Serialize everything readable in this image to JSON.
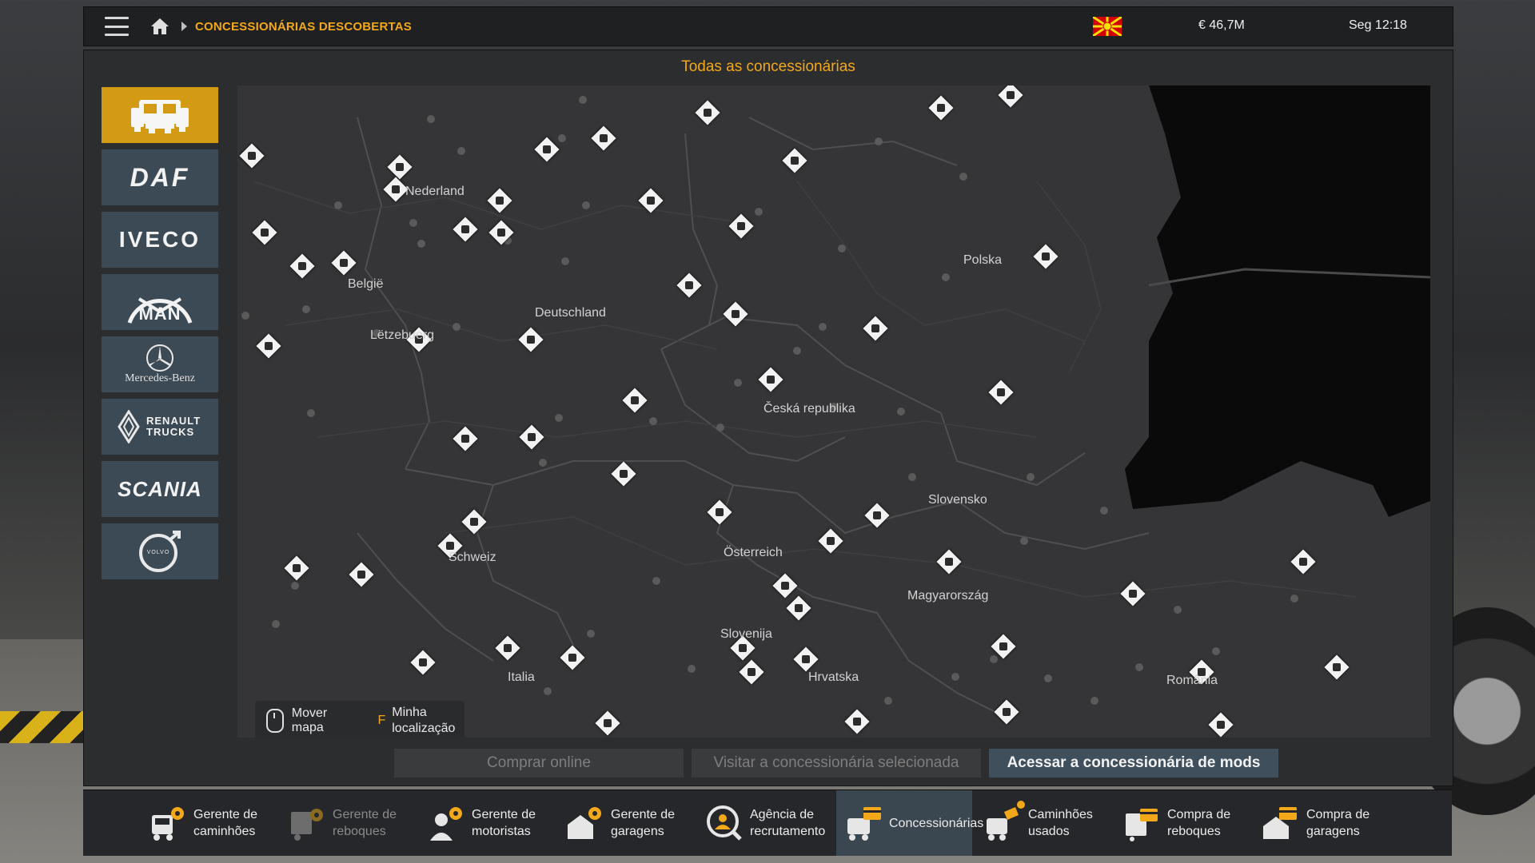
{
  "topbar": {
    "breadcrumb": "CONCESSIONÁRIAS DESCOBERTAS",
    "money": "€ 46,7M",
    "clock": "Seg 12:18",
    "flag_colors": {
      "field": "#d20000",
      "sun": "#f8e000"
    }
  },
  "panel": {
    "title": "Todas as concessionárias"
  },
  "brands": [
    {
      "name": "all-brands",
      "label": "",
      "icon": "truck-group-icon",
      "active": true
    },
    {
      "name": "daf",
      "label": "DAF",
      "active": false
    },
    {
      "name": "iveco",
      "label": "IVECO",
      "active": false
    },
    {
      "name": "man",
      "label": "MAN",
      "active": false
    },
    {
      "name": "mercedes-benz",
      "label": "Mercedes-Benz",
      "active": false
    },
    {
      "name": "renault-trucks",
      "label": "RENAULT TRUCKS",
      "active": false
    },
    {
      "name": "scania",
      "label": "SCANIA",
      "active": false
    },
    {
      "name": "volvo",
      "label": "VOLVO",
      "active": false
    }
  ],
  "map": {
    "countries": [
      "Nederland",
      "België",
      "Lëtzebuerg",
      "Deutschland",
      "Polska",
      "Česká republika",
      "Slovensko",
      "Österreich",
      "Magyarország",
      "Schweiz",
      "Slovenija",
      "Hrvatska",
      "Italia",
      "România"
    ],
    "hint_move": "Mover mapa",
    "hint_key": "F",
    "hint_location": "Minha localização"
  },
  "actions": {
    "buy_online": "Comprar online",
    "visit_selected": "Visitar a concessionária selecionada",
    "mods_dealer": "Acessar a concessionária de mods"
  },
  "bottomnav": [
    {
      "label": "Gerente de caminhões",
      "icon": "truck-manager-icon"
    },
    {
      "label": "Gerente de reboques",
      "icon": "trailer-manager-icon"
    },
    {
      "label": "Gerente de motoristas",
      "icon": "driver-manager-icon"
    },
    {
      "label": "Gerente de garagens",
      "icon": "garage-manager-icon"
    },
    {
      "label": "Agência de recrutamento",
      "icon": "recruitment-agency-icon"
    },
    {
      "label": "Concessionárias",
      "icon": "dealership-icon"
    },
    {
      "label": "Caminhões usados",
      "icon": "used-trucks-icon"
    },
    {
      "label": "Compra de reboques",
      "icon": "trailer-purchase-icon"
    },
    {
      "label": "Compra de garagens",
      "icon": "garage-purchase-icon"
    }
  ]
}
